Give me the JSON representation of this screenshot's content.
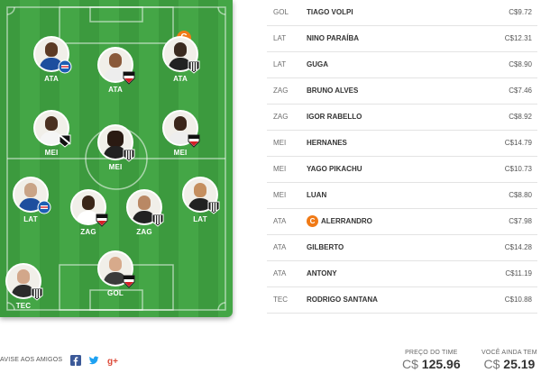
{
  "colors": {
    "field": "#3c9a3e",
    "captain": "#f07a16"
  },
  "field": {
    "players": [
      {
        "pos": "ATA",
        "badge": "bahia-crest-icon",
        "captain": false
      },
      {
        "pos": "ATA",
        "badge": "sao-paulo-crest-icon",
        "captain": false
      },
      {
        "pos": "ATA",
        "badge": "atletico-mg-crest-icon",
        "captain": true,
        "captain_label": "C"
      },
      {
        "pos": "MEI",
        "badge": "vasco-crest-icon",
        "captain": false
      },
      {
        "pos": "MEI",
        "badge": "atletico-mg-crest-icon",
        "captain": false
      },
      {
        "pos": "MEI",
        "badge": "sao-paulo-crest-icon",
        "captain": false
      },
      {
        "pos": "LAT",
        "badge": "bahia-crest-icon",
        "captain": false
      },
      {
        "pos": "ZAG",
        "badge": "sao-paulo-crest-icon",
        "captain": false
      },
      {
        "pos": "ZAG",
        "badge": "atletico-mg-crest-icon",
        "captain": false
      },
      {
        "pos": "LAT",
        "badge": "atletico-mg-crest-icon",
        "captain": false
      },
      {
        "pos": "TEC",
        "badge": "atletico-mg-crest-icon",
        "captain": false
      },
      {
        "pos": "GOL",
        "badge": "sao-paulo-crest-icon",
        "captain": false
      }
    ]
  },
  "list": {
    "rows": [
      {
        "pos": "GOL",
        "name": "TIAGO VOLPI",
        "price": "C$9.72"
      },
      {
        "pos": "LAT",
        "name": "NINO PARAÍBA",
        "price": "C$12.31"
      },
      {
        "pos": "LAT",
        "name": "GUGA",
        "price": "C$8.90"
      },
      {
        "pos": "ZAG",
        "name": "BRUNO ALVES",
        "price": "C$7.46"
      },
      {
        "pos": "ZAG",
        "name": "IGOR RABELLO",
        "price": "C$8.92"
      },
      {
        "pos": "MEI",
        "name": "HERNANES",
        "price": "C$14.79"
      },
      {
        "pos": "MEI",
        "name": "YAGO PIKACHU",
        "price": "C$10.73"
      },
      {
        "pos": "MEI",
        "name": "LUAN",
        "price": "C$8.80"
      },
      {
        "pos": "ATA",
        "name": "ALERRANDRO",
        "price": "C$7.98",
        "captain_label": "C"
      },
      {
        "pos": "ATA",
        "name": "GILBERTO",
        "price": "C$14.28"
      },
      {
        "pos": "ATA",
        "name": "ANTONY",
        "price": "C$11.19"
      },
      {
        "pos": "TEC",
        "name": "RODRIGO SANTANA",
        "price": "C$10.88"
      }
    ]
  },
  "footer": {
    "share_label": "AVISE AOS AMIGOS",
    "social_icons": [
      "facebook-icon",
      "twitter-icon",
      "google-plus-icon"
    ],
    "team_price_label": "PREÇO DO TIME",
    "team_price_currency": "C$",
    "team_price_value": "125.96",
    "remaining_label": "VOCÊ AINDA TEM",
    "remaining_currency": "C$",
    "remaining_value": "25.19"
  }
}
